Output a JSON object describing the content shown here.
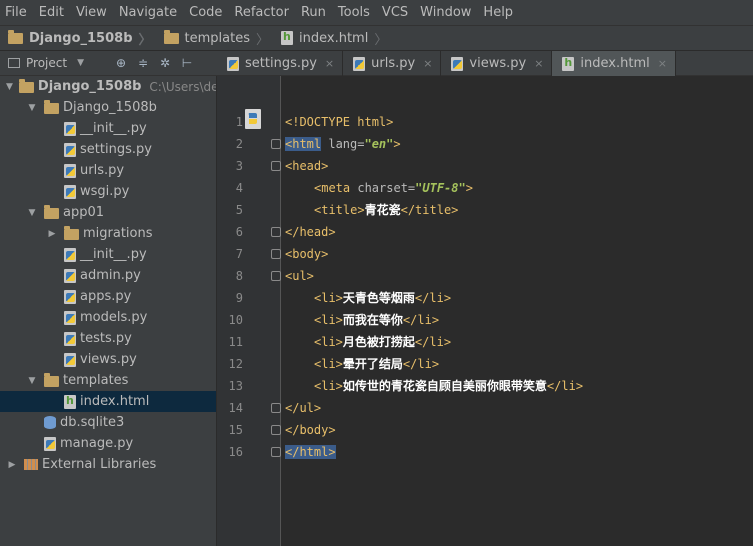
{
  "menu": [
    "File",
    "Edit",
    "View",
    "Navigate",
    "Code",
    "Refactor",
    "Run",
    "Tools",
    "VCS",
    "Window",
    "Help"
  ],
  "breadcrumb": [
    "Django_1508b",
    "templates",
    "index.html"
  ],
  "project_selector": "Project",
  "tabs": [
    {
      "label": "settings.py",
      "icon": "python-file-icon",
      "active": false
    },
    {
      "label": "urls.py",
      "icon": "python-file-icon",
      "active": false
    },
    {
      "label": "views.py",
      "icon": "python-file-icon",
      "active": false
    },
    {
      "label": "index.html",
      "icon": "html-file-icon",
      "active": true
    }
  ],
  "tree": [
    {
      "label": "Django_1508b",
      "hint": "C:\\Users\\dell\\",
      "icon": "folder-icon",
      "arrow": "expanded",
      "depth": 0,
      "bold": true
    },
    {
      "label": "Django_1508b",
      "icon": "folder-icon",
      "arrow": "expanded",
      "depth": 1
    },
    {
      "label": "__init__.py",
      "icon": "python-file-icon",
      "depth": 2
    },
    {
      "label": "settings.py",
      "icon": "python-file-icon",
      "depth": 2
    },
    {
      "label": "urls.py",
      "icon": "python-file-icon",
      "depth": 2
    },
    {
      "label": "wsgi.py",
      "icon": "python-file-icon",
      "depth": 2
    },
    {
      "label": "app01",
      "icon": "folder-icon",
      "arrow": "expanded",
      "depth": 1
    },
    {
      "label": "migrations",
      "icon": "folder-icon",
      "arrow": "collapsed",
      "depth": 2
    },
    {
      "label": "__init__.py",
      "icon": "python-file-icon",
      "depth": 2
    },
    {
      "label": "admin.py",
      "icon": "python-file-icon",
      "depth": 2
    },
    {
      "label": "apps.py",
      "icon": "python-file-icon",
      "depth": 2
    },
    {
      "label": "models.py",
      "icon": "python-file-icon",
      "depth": 2
    },
    {
      "label": "tests.py",
      "icon": "python-file-icon",
      "depth": 2
    },
    {
      "label": "views.py",
      "icon": "python-file-icon",
      "depth": 2
    },
    {
      "label": "templates",
      "icon": "folder-icon",
      "arrow": "expanded",
      "depth": 1
    },
    {
      "label": "index.html",
      "icon": "html-file-icon",
      "depth": 2,
      "selected": true
    },
    {
      "label": "db.sqlite3",
      "icon": "database-icon",
      "depth": 1
    },
    {
      "label": "manage.py",
      "icon": "python-file-icon",
      "depth": 1
    },
    {
      "label": "External Libraries",
      "icon": "library-icon",
      "arrow": "collapsed",
      "depth": 0
    }
  ],
  "code": {
    "line_numbers": [
      "1",
      "2",
      "3",
      "4",
      "5",
      "6",
      "7",
      "8",
      "9",
      "10",
      "11",
      "12",
      "13",
      "14",
      "15",
      "16"
    ],
    "doctype": "<!DOCTYPE html>",
    "html_open": "<html",
    "lang_attr": " lang=",
    "lang_val": "\"en\"",
    "gt": ">",
    "head_open": "<head>",
    "meta_open": "<meta",
    "charset_attr": " charset=",
    "charset_val": "\"UTF-8\"",
    "title_open": "<title>",
    "title_text": "青花瓷",
    "title_close": "</title>",
    "head_close": "</head>",
    "body_open": "<body>",
    "ul_open": "<ul>",
    "li_open": "<li>",
    "li_close": "</li>",
    "items": [
      "天青色等烟雨",
      "而我在等你",
      "月色被打捞起",
      "晕开了结局",
      "如传世的青花瓷自顾自美丽你眼带笑意"
    ],
    "ul_close": "</ul>",
    "body_close": "</body>",
    "html_close": "</html>"
  },
  "colors": {
    "tag": "#e8bf6a",
    "attr_value": "#a5c25c",
    "background": "#2b2b2b",
    "panel": "#3c3f41",
    "selection": "#0d293e"
  }
}
